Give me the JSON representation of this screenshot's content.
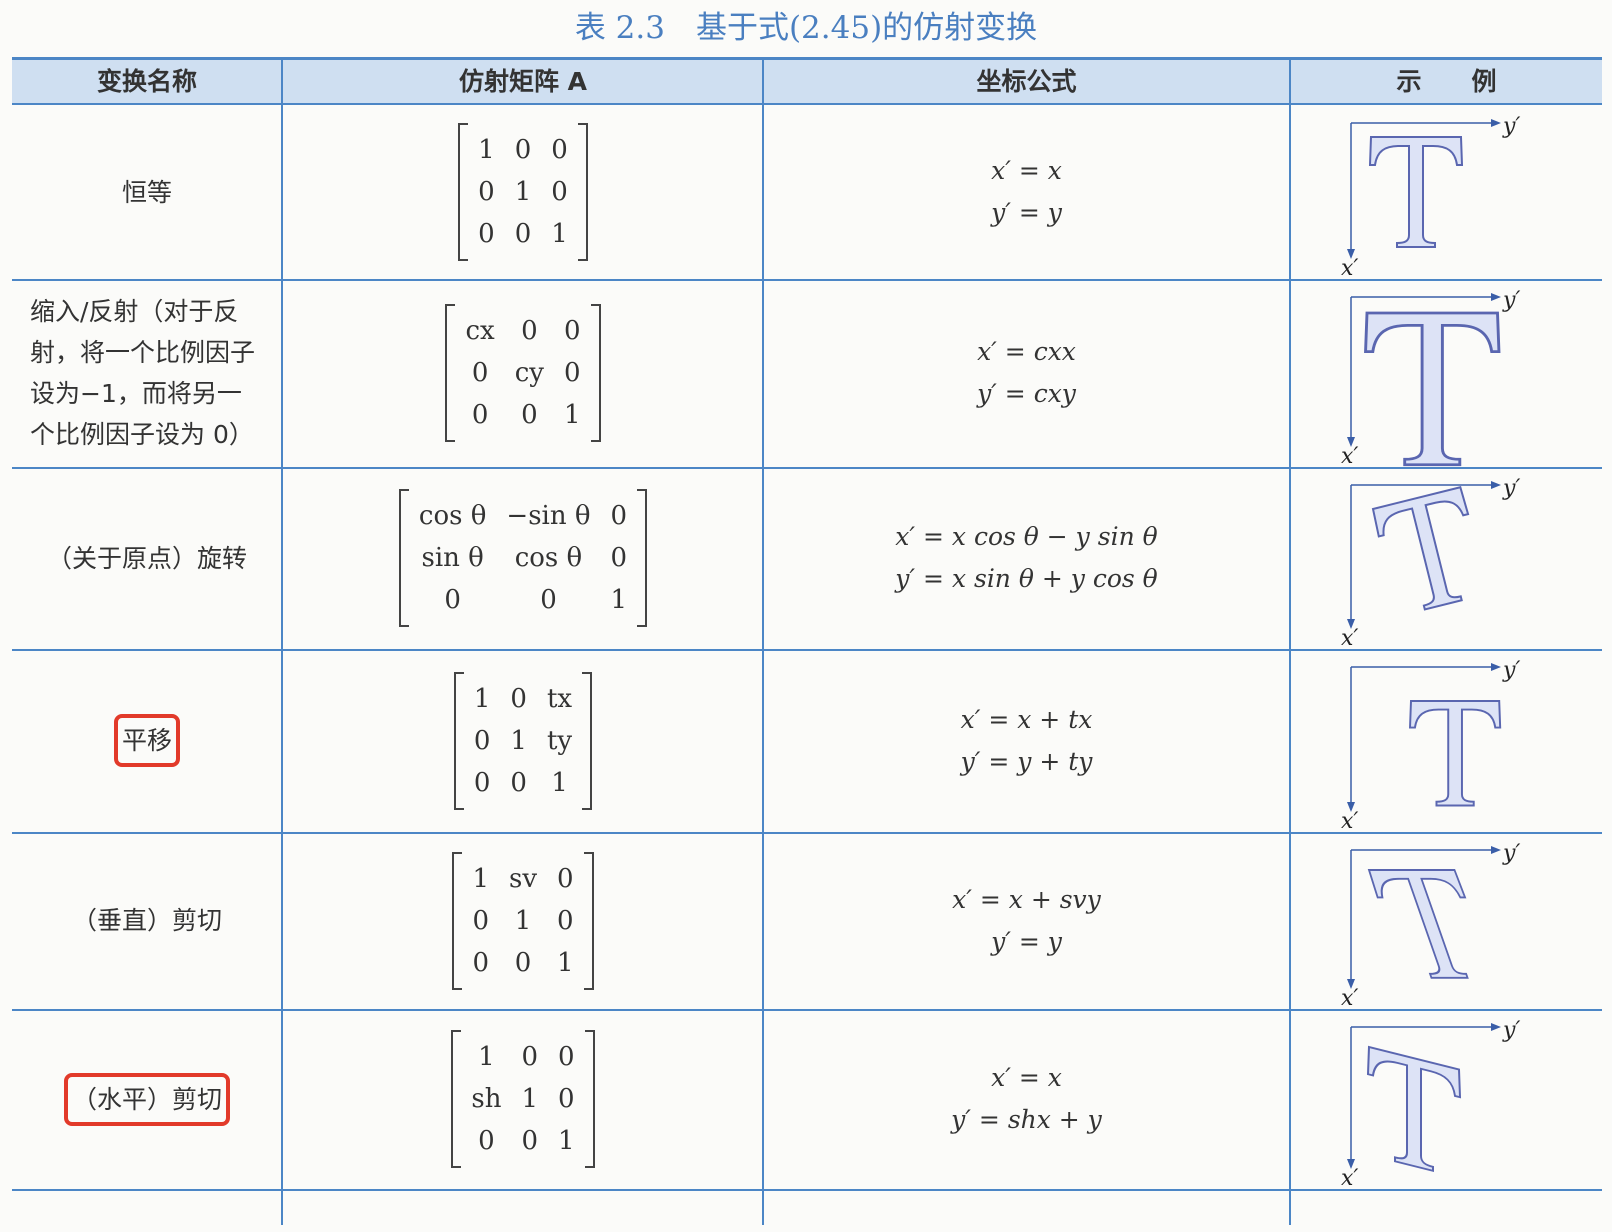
{
  "caption": "表 2.3　基于式(2.45)的仿射变换",
  "header": {
    "col1": "变换名称",
    "col2": "仿射矩阵 A",
    "col3": "坐标公式",
    "col4": "示　　例"
  },
  "rows": [
    {
      "name": "恒等",
      "highlighted": false,
      "matrix": [
        [
          "1",
          "0",
          "0"
        ],
        [
          "0",
          "1",
          "0"
        ],
        [
          "0",
          "0",
          "1"
        ]
      ],
      "formula": [
        "x′ = x",
        "y′ = y"
      ],
      "example": {
        "transform": "identity",
        "x_label": "x′",
        "y_label": "y′"
      }
    },
    {
      "name": "缩入/反射（对于反射，将一个比例因子设为−1，而将另一个比例因子设为 0）",
      "highlighted": false,
      "matrix": [
        [
          "cx",
          "0",
          "0"
        ],
        [
          "0",
          "cy",
          "0"
        ],
        [
          "0",
          "0",
          "1"
        ]
      ],
      "formula": [
        "x′ = cxx",
        "y′ = cxy"
      ],
      "example": {
        "transform": "scale",
        "x_label": "x′",
        "y_label": "y′"
      }
    },
    {
      "name": "（关于原点）旋转",
      "highlighted": false,
      "matrix": [
        [
          "cos θ",
          "−sin θ",
          "0"
        ],
        [
          "sin θ",
          "cos θ",
          "0"
        ],
        [
          "0",
          "0",
          "1"
        ]
      ],
      "formula": [
        "x′ = x cos θ − y sin θ",
        "y′ = x sin θ + y cos θ"
      ],
      "example": {
        "transform": "rotate",
        "x_label": "x′",
        "y_label": "y′"
      }
    },
    {
      "name": "平移",
      "highlighted": true,
      "matrix": [
        [
          "1",
          "0",
          "tx"
        ],
        [
          "0",
          "1",
          "ty"
        ],
        [
          "0",
          "0",
          "1"
        ]
      ],
      "formula": [
        "x′ = x + tx",
        "y′ = y + ty"
      ],
      "example": {
        "transform": "translate",
        "x_label": "x′",
        "y_label": "y′"
      }
    },
    {
      "name": "（垂直）剪切",
      "highlighted": false,
      "matrix": [
        [
          "1",
          "sv",
          "0"
        ],
        [
          "0",
          "1",
          "0"
        ],
        [
          "0",
          "0",
          "1"
        ]
      ],
      "formula": [
        "x′ = x + svy",
        "y′ = y"
      ],
      "example": {
        "transform": "shear-vertical",
        "x_label": "x′",
        "y_label": "y′"
      }
    },
    {
      "name": "（水平）剪切",
      "highlighted": true,
      "matrix": [
        [
          "1",
          "0",
          "0"
        ],
        [
          "sh",
          "1",
          "0"
        ],
        [
          "0",
          "0",
          "1"
        ]
      ],
      "formula": [
        "x′ = x",
        "y′ = shx + y"
      ],
      "example": {
        "transform": "shear-horizontal",
        "x_label": "x′",
        "y_label": "y′"
      }
    }
  ],
  "colors": {
    "rule": "#4c86c6",
    "header_bg": "#cfdff1",
    "highlight": "#e23a2a",
    "letter_fill": "#dde3f6",
    "letter_stroke": "#5a66b0",
    "caption": "#4a7fc0"
  }
}
